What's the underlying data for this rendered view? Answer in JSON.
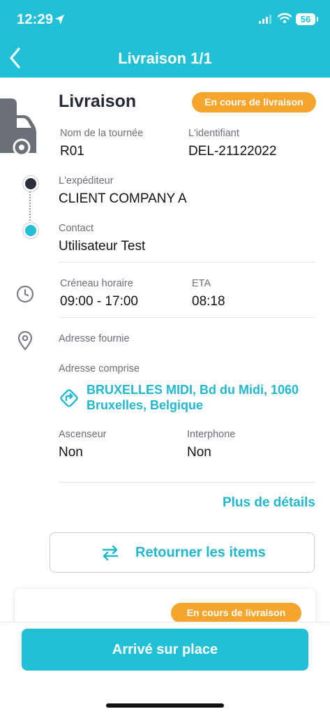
{
  "status_bar": {
    "time": "12:29",
    "battery": "56"
  },
  "nav": {
    "title": "Livraison 1/1"
  },
  "delivery": {
    "heading": "Livraison",
    "status_badge": "En cours de livraison",
    "tour_name_label": "Nom de la tournée",
    "tour_name_value": "R01",
    "identifier_label": "L'identifiant",
    "identifier_value": "DEL-21122022",
    "sender_label": "L'expéditeur",
    "sender_value": "CLIENT COMPANY A",
    "contact_label": "Contact",
    "contact_value": "Utilisateur Test",
    "slot_label": "Créneau horaire",
    "slot_value": "09:00 - 17:00",
    "eta_label": "ETA",
    "eta_value": "08:18",
    "provided_address_label": "Adresse fournie",
    "understood_address_label": "Adresse comprise",
    "understood_address_value": "BRUXELLES MIDI, Bd du Midi, 1060 Bruxelles, Belgique",
    "elevator_label": "Ascenseur",
    "elevator_value": "Non",
    "intercom_label": "Interphone",
    "intercom_value": "Non",
    "more_details": "Plus de détails"
  },
  "actions": {
    "return_items": "Retourner les items",
    "arrived": "Arrivé sur place"
  },
  "second_card": {
    "status_badge": "En cours de livraison"
  },
  "colors": {
    "primary": "#22c0d6",
    "badge": "#f5a42c",
    "text_dark": "#252a36"
  },
  "icons": [
    "location-arrow-icon",
    "signal-icon",
    "wifi-icon",
    "battery-icon",
    "back-chevron-icon",
    "truck-icon",
    "clock-icon",
    "map-pin-icon",
    "route-direction-icon",
    "swap-arrows-icon"
  ]
}
